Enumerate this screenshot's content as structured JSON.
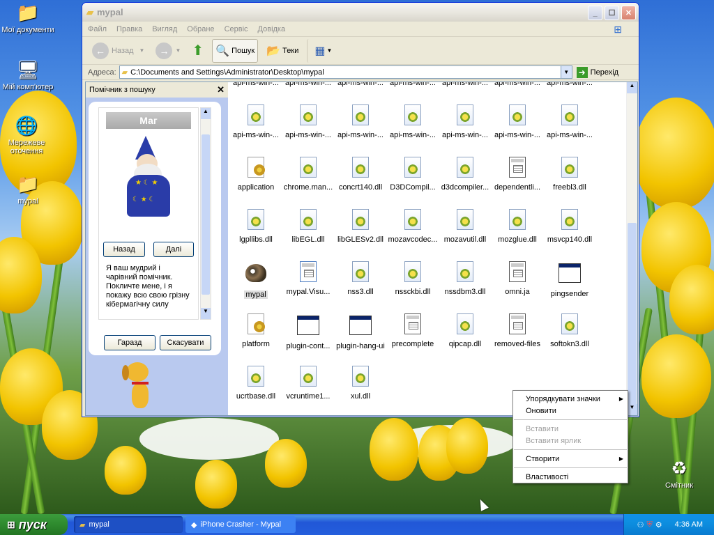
{
  "desktop": {
    "icons": [
      {
        "label": "Мої документи",
        "icon": "my-documents-icon"
      },
      {
        "label": "Мій комп'ютер",
        "icon": "my-computer-icon"
      },
      {
        "label": "Мережеве оточення",
        "icon": "network-icon"
      },
      {
        "label": "mypal",
        "icon": "folder-icon"
      },
      {
        "label": "Смітник",
        "icon": "recycle-bin-icon"
      }
    ]
  },
  "window": {
    "title": "mypal",
    "menu": [
      "Файл",
      "Правка",
      "Вигляд",
      "Обране",
      "Сервіс",
      "Довідка"
    ],
    "toolbar": {
      "back": "Назад",
      "search": "Пошук",
      "folders": "Теки"
    },
    "address": {
      "label": "Адреса:",
      "value": "C:\\Documents and Settings\\Administrator\\Desktop\\mypal",
      "go": "Перехід"
    }
  },
  "search_pane": {
    "title": "Помічник з пошуку",
    "character_name": "Маг",
    "back": "Назад",
    "next": "Далі",
    "text": "Я ваш мудрий і чарівний помічник. Покличте мене, і я покажу всю свою грізну кібермагічну силу",
    "ok": "Гаразд",
    "cancel": "Скасувати"
  },
  "files": [
    {
      "label": "api-ms-win-...",
      "type": "dll"
    },
    {
      "label": "api-ms-win-...",
      "type": "dll"
    },
    {
      "label": "api-ms-win-...",
      "type": "dll"
    },
    {
      "label": "api-ms-win-...",
      "type": "dll"
    },
    {
      "label": "api-ms-win-...",
      "type": "dll"
    },
    {
      "label": "api-ms-win-...",
      "type": "dll"
    },
    {
      "label": "api-ms-win-...",
      "type": "dll"
    },
    {
      "label": "api-ms-win-...",
      "type": "dll"
    },
    {
      "label": "api-ms-win-...",
      "type": "dll"
    },
    {
      "label": "api-ms-win-...",
      "type": "dll"
    },
    {
      "label": "api-ms-win-...",
      "type": "dll"
    },
    {
      "label": "api-ms-win-...",
      "type": "dll"
    },
    {
      "label": "api-ms-win-...",
      "type": "dll"
    },
    {
      "label": "api-ms-win-...",
      "type": "dll"
    },
    {
      "label": "application",
      "type": "cfg"
    },
    {
      "label": "chrome.man...",
      "type": "dll"
    },
    {
      "label": "concrt140.dll",
      "type": "dll"
    },
    {
      "label": "D3DCompil...",
      "type": "dll"
    },
    {
      "label": "d3dcompiler...",
      "type": "dll"
    },
    {
      "label": "dependentli...",
      "type": "txt"
    },
    {
      "label": "freebl3.dll",
      "type": "dll"
    },
    {
      "label": "lgpllibs.dll",
      "type": "dll"
    },
    {
      "label": "libEGL.dll",
      "type": "dll"
    },
    {
      "label": "libGLESv2.dll",
      "type": "dll"
    },
    {
      "label": "mozavcodec...",
      "type": "dll"
    },
    {
      "label": "mozavutil.dll",
      "type": "dll"
    },
    {
      "label": "mozglue.dll",
      "type": "dll"
    },
    {
      "label": "msvcp140.dll",
      "type": "dll"
    },
    {
      "label": "mypal",
      "type": "app"
    },
    {
      "label": "mypal.Visu...",
      "type": "web"
    },
    {
      "label": "nss3.dll",
      "type": "dll"
    },
    {
      "label": "nssckbi.dll",
      "type": "dll"
    },
    {
      "label": "nssdbm3.dll",
      "type": "dll"
    },
    {
      "label": "omni.ja",
      "type": "txt"
    },
    {
      "label": "pingsender",
      "type": "exe"
    },
    {
      "label": "platform",
      "type": "cfg"
    },
    {
      "label": "plugin-cont...",
      "type": "exe"
    },
    {
      "label": "plugin-hang-ui",
      "type": "exe"
    },
    {
      "label": "precomplete",
      "type": "txt"
    },
    {
      "label": "qipcap.dll",
      "type": "dll"
    },
    {
      "label": "removed-files",
      "type": "txt"
    },
    {
      "label": "softokn3.dll",
      "type": "dll"
    },
    {
      "label": "ucrtbase.dll",
      "type": "dll"
    },
    {
      "label": "vcruntime1...",
      "type": "dll"
    },
    {
      "label": "xul.dll",
      "type": "dll"
    }
  ],
  "context_menu": {
    "arrange": "Упорядкувати значки",
    "refresh": "Оновити",
    "paste": "Вставити",
    "paste_shortcut": "Вставити ярлик",
    "new": "Створити",
    "properties": "Властивості"
  },
  "taskbar": {
    "start": "пуск",
    "tasks": [
      "mypal",
      "iPhone Crasher - Mypal"
    ],
    "clock": "4:36 AM"
  }
}
